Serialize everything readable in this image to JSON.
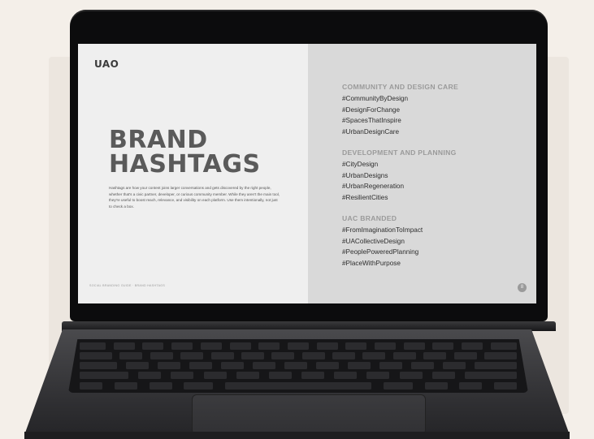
{
  "slide": {
    "logo": "UAO",
    "title_line1": "BRAND",
    "title_line2": "HASHTAGS",
    "body": "Hashtags are how your content joins larger conversations and gets discovered by the right people, whether that's a civic partner, developer, or curious community member. While they aren't the main tool, they're useful to boost reach, relevance, and visibility on each platform. Use them intentionally, not just to check a box.",
    "footer": "SOCIAL BRANDING GUIDE · BRAND HASHTAGS",
    "page_number": "8"
  },
  "sections": [
    {
      "heading": "COMMUNITY AND DESIGN CARE",
      "tags": [
        "#CommunityByDesign",
        "#DesignForChange",
        "#SpacesThatInspire",
        "#UrbanDesignCare"
      ]
    },
    {
      "heading": "DEVELOPMENT AND PLANNING",
      "tags": [
        "#CityDesign",
        "#UrbanDesigns",
        "#UrbanRegeneration",
        "#ResilientCities"
      ]
    },
    {
      "heading": "UAC BRANDED",
      "tags": [
        "#FromImaginationToImpact",
        "#UACollectiveDesign",
        "#PeoplePoweredPlanning",
        "#PlaceWithPurpose"
      ]
    }
  ],
  "colors": {
    "background": "#f4efe9",
    "left_page": "#efefef",
    "right_page": "#d9d9d9",
    "title": "#5a5a5a",
    "heading": "#9a9a9a",
    "laptop_body": "#3a3a3d"
  }
}
